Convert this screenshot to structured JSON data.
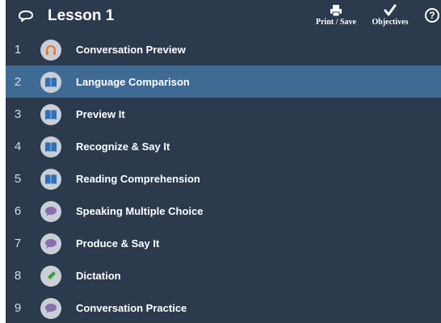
{
  "header": {
    "title": "Lesson 1",
    "lesson_icon": "lesson-loop-icon",
    "tools": {
      "print_save": {
        "label": "Print / Save",
        "icon": "printer-icon"
      },
      "objectives": {
        "label": "Objectives",
        "icon": "checkmark-icon"
      },
      "help": {
        "symbol": "?",
        "icon": "help-icon"
      }
    }
  },
  "lesson_items": [
    {
      "number": "1",
      "label": "Conversation Preview",
      "icon": "headphones-icon",
      "selected": false
    },
    {
      "number": "2",
      "label": "Language Comparison",
      "icon": "book-icon",
      "selected": true
    },
    {
      "number": "3",
      "label": "Preview It",
      "icon": "book-icon",
      "selected": false
    },
    {
      "number": "4",
      "label": "Recognize & Say It",
      "icon": "book-icon",
      "selected": false
    },
    {
      "number": "5",
      "label": "Reading Comprehension",
      "icon": "book-icon",
      "selected": false
    },
    {
      "number": "6",
      "label": "Speaking Multiple Choice",
      "icon": "speech-bubble-icon",
      "selected": false
    },
    {
      "number": "7",
      "label": "Produce & Say It",
      "icon": "speech-bubble-icon",
      "selected": false
    },
    {
      "number": "8",
      "label": "Dictation",
      "icon": "pencil-icon",
      "selected": false
    },
    {
      "number": "9",
      "label": "Conversation Practice",
      "icon": "speech-bubble-icon",
      "selected": false
    }
  ],
  "colors": {
    "background": "#2b3a4c",
    "selected_row": "#3e6a93",
    "badge": "#c9cfd6",
    "headphones": "#e07a3a",
    "book": "#2e6fb8",
    "speech": "#8a6fb0",
    "pencil": "#3c9a3c"
  }
}
